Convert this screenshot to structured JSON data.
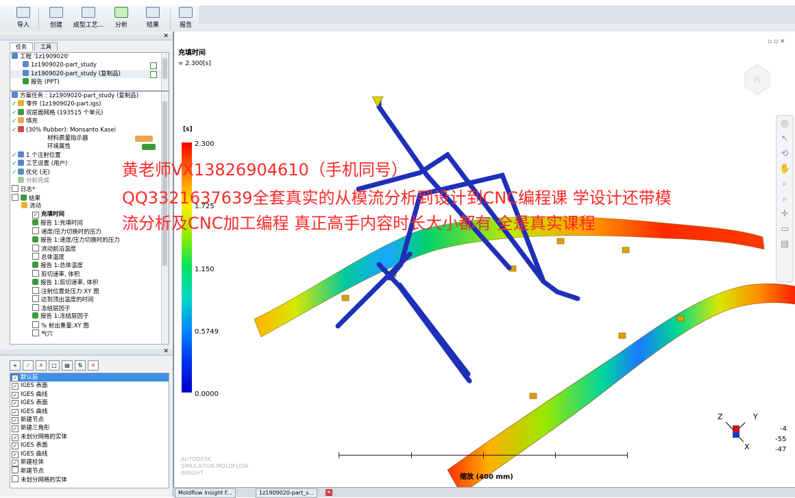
{
  "ribbon": {
    "buttons": [
      {
        "label": "导入"
      },
      {
        "label": "创建"
      },
      {
        "label": "成型工艺..."
      },
      {
        "label": "分析"
      },
      {
        "label": "结果"
      },
      {
        "label": "报告"
      }
    ]
  },
  "left_tabs": {
    "task": "任务",
    "tools": "工具"
  },
  "project_tree": [
    {
      "text": "工程 '1z1909020'"
    },
    {
      "text": "1z1909020-part_study"
    },
    {
      "text": "1z1909020-part_study (复制品)"
    },
    {
      "text": "报告 (PPT)"
    }
  ],
  "study_tree": [
    {
      "text": "方案任务 : 1z1909020-part_study (复制品)"
    },
    {
      "text": "零件 (1z1909020-part.igs)"
    },
    {
      "text": "双层面网格 (193515 个单元)"
    },
    {
      "text": "填充"
    },
    {
      "text": "(30% Rubber): Monsanto Kasei"
    },
    {
      "text": "材料质量指示器"
    },
    {
      "text": "环境属性"
    },
    {
      "text": "1 个注射位置"
    },
    {
      "text": "工艺设置 (用户)"
    },
    {
      "text": "优化 (无)"
    },
    {
      "text": "分析完成"
    },
    {
      "text": "日志*"
    },
    {
      "text": "结果"
    },
    {
      "text": "流动"
    },
    {
      "text": "充填时间"
    },
    {
      "text": "报告 1:充填时间"
    },
    {
      "text": "速度/压力切换时的压力"
    },
    {
      "text": "报告 1:速度/压力切换时的压力"
    },
    {
      "text": "流动前沿温度"
    },
    {
      "text": "总体温度"
    },
    {
      "text": "报告 1:总体温度"
    },
    {
      "text": "剪切速率, 体积"
    },
    {
      "text": "报告 1:剪切速率, 体积"
    },
    {
      "text": "注射位置处压力:XY 图"
    },
    {
      "text": "达到顶出温度的时间"
    },
    {
      "text": "冻结层因子"
    },
    {
      "text": "报告 1:冻结层因子"
    },
    {
      "text": "% 射出重量:XY 图"
    },
    {
      "text": "气穴"
    }
  ],
  "layers": [
    {
      "text": "默认层"
    },
    {
      "text": "IGES 表面"
    },
    {
      "text": "IGES 曲线"
    },
    {
      "text": "IGES 表面"
    },
    {
      "text": "IGES 曲线"
    },
    {
      "text": "新建节点"
    },
    {
      "text": "新建三角形"
    },
    {
      "text": "未划分网格的实体"
    },
    {
      "text": "IGES 表面"
    },
    {
      "text": "IGES 曲线"
    },
    {
      "text": "新建柱体"
    },
    {
      "text": "新建节点"
    },
    {
      "text": "未划分网格的实体"
    }
  ],
  "viewport": {
    "result_title": "充填时间",
    "result_value": "= 2.300[s]",
    "legend_unit": "[s]",
    "legend_values": [
      "2.300",
      "1.725",
      "1.150",
      "0.5749",
      "0.0000"
    ],
    "scale_label": "缩放 (400 mm)",
    "axis_numbers": [
      "-4",
      "-55",
      "-47"
    ],
    "axis_letters": [
      "Z",
      "Y",
      "X"
    ],
    "brand": [
      "AUTODESK",
      "SIMULATION MOLDFLOW",
      "INSIGHT"
    ]
  },
  "watermark": {
    "line1": "黄老师VX13826904610（手机同号）",
    "line2": "QQ3321637639全套真实的从模流分析到设计到CNC编程课  学设计还带模",
    "line3": "流分析及CNC加工编程 真正高手内容时长大小都有 全是真实课程"
  },
  "taskbar": {
    "items": [
      "Moldflow Insight F...",
      "1z1909020-part_s..."
    ]
  },
  "colors": {
    "legend_max": "#ff0000",
    "legend_min": "#0000c8",
    "runner": "#1e2fb8",
    "watermark": "#ff2a2a"
  }
}
